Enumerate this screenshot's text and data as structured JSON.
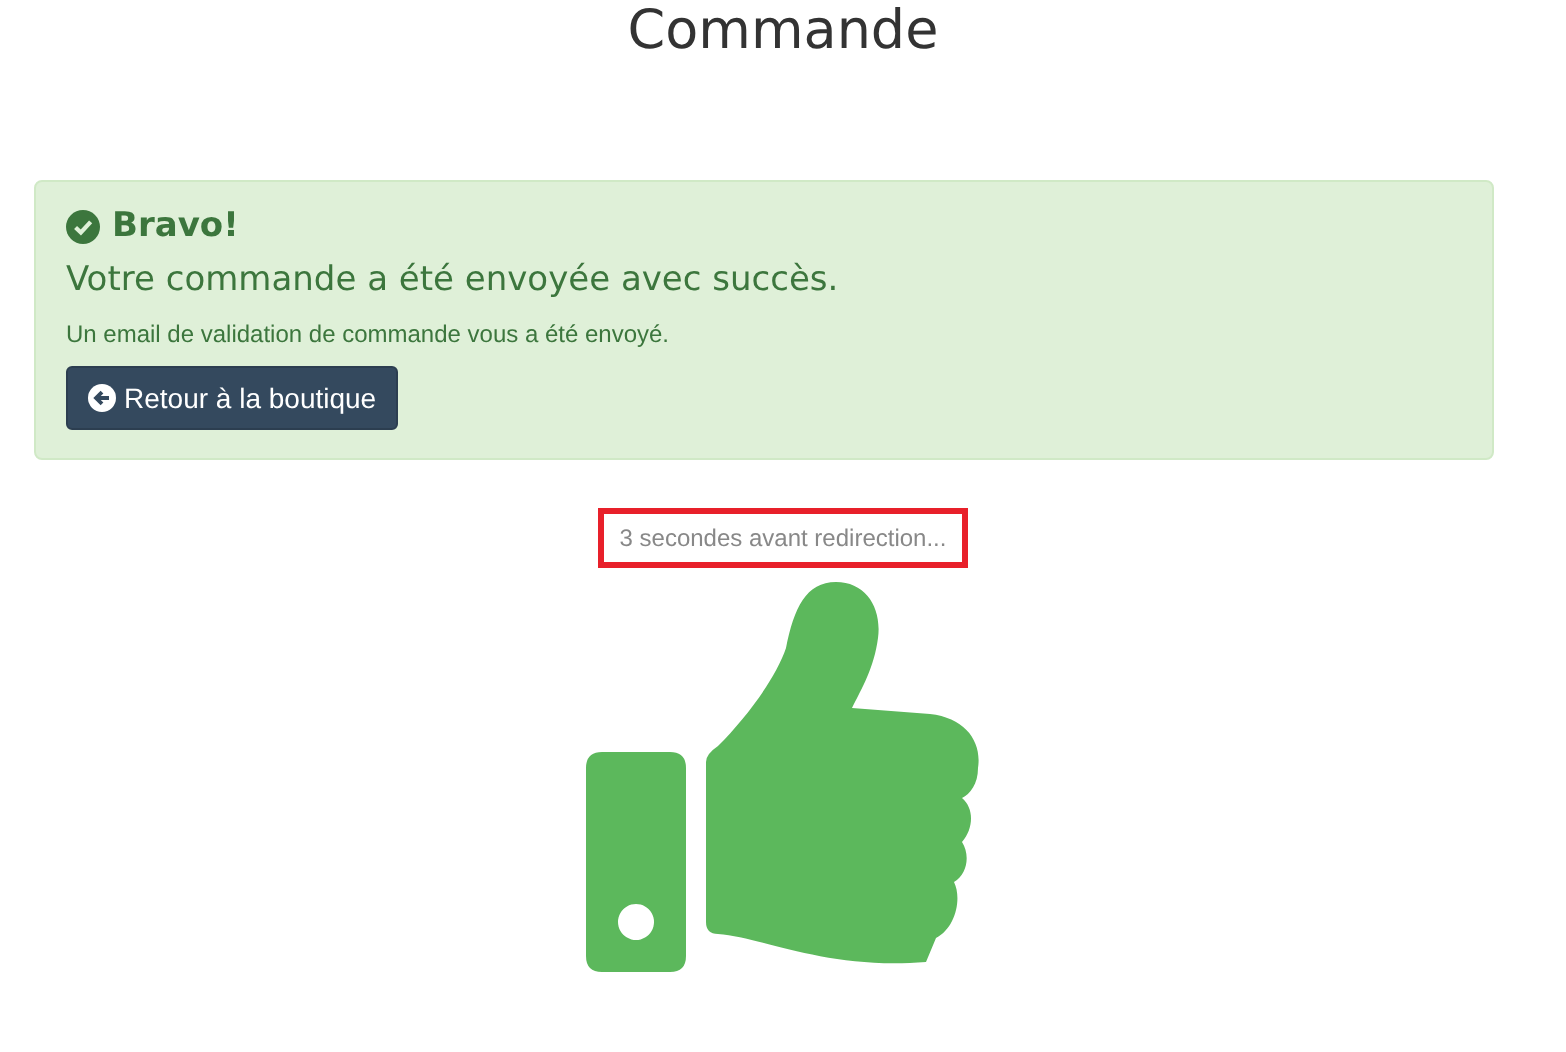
{
  "page_title": "Commande",
  "alert": {
    "title": "Bravo!",
    "message": "Votre commande a été envoyée avec succès.",
    "detail": "Un email de validation de commande vous a été envoyé.",
    "button": "Retour à la boutique"
  },
  "countdown": "3 secondes avant redirection..."
}
